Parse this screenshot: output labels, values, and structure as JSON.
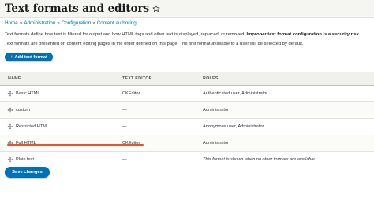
{
  "page": {
    "title": "Text formats and editors"
  },
  "breadcrumb": [
    "Home",
    "Administration",
    "Configuration",
    "Content authoring"
  ],
  "description": {
    "line1_text": "Text formats define how text is filtered for output and how HTML tags and other text is displayed, replaced, or removed.",
    "line1_bold": "Improper text format configuration is a security risk.",
    "line2": "Text formats are presented on content editing pages in the order defined on this page. The first format available to a user will be selected by default."
  },
  "add_button_label": "Add text format",
  "add_button_plus": "+",
  "table": {
    "headers": {
      "name": "NAME",
      "editor": "TEXT EDITOR",
      "roles": "ROLES"
    },
    "rows": [
      {
        "name": "Basic HTML",
        "editor": "CKEditor",
        "roles": "Authenticated user, Administrator"
      },
      {
        "name": "custom",
        "editor": "—",
        "roles": "Administrator"
      },
      {
        "name": "Restricted HTML",
        "editor": "—",
        "roles": "Anonymous user, Administrator"
      },
      {
        "name": "Full HTML",
        "editor": "CKEditor",
        "roles": "Administrator"
      },
      {
        "name": "Plain text",
        "editor": "—",
        "roles": "This format is shown when no other formats are available"
      }
    ]
  },
  "save_button_label": "Save changes",
  "colors": {
    "accent": "#0071b8",
    "link": "#0074bd",
    "highlight": "#e8532a"
  },
  "icons": {
    "star": "star-icon",
    "drag": "drag-handle-icon"
  }
}
